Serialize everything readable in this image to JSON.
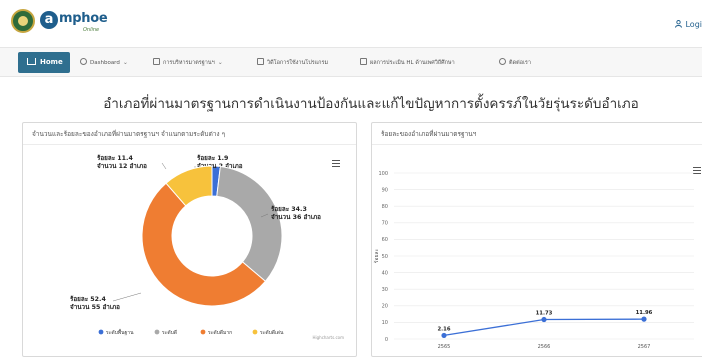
{
  "header": {
    "logo_letter": "a",
    "logo_word": "mphoe",
    "logo_sub": "Online",
    "login_label": "Logi"
  },
  "nav": {
    "home": "Home",
    "dashboard": "Dashboard",
    "manage_standards": "การบริหารมาตรฐานฯ",
    "manual": "วิดีโอการใช้งานโปรแกรม",
    "hl_results": "ผลการประเมิน HL ด้านเพศวิถีศึกษา",
    "contact": "ติดต่อเรา"
  },
  "page": {
    "title": "อำเภอที่ผ่านมาตรฐานการดำเนินงานป้องกันและแก้ไขปัญหาการตั้งครรภ์ในวัยรุ่นระดับอำเภอ"
  },
  "chart_data": [
    {
      "type": "pie",
      "title": "จำนวนและร้อยละของอำเภอที่ผ่านมาตรฐานฯ จำแนกตามระดับต่าง ๆ",
      "credit": "Highcharts.com",
      "legend_position": "bottom",
      "slices": [
        {
          "name": "ระดับพื้นฐาน",
          "percent": 1.9,
          "count": 2,
          "pct_label": "ร้อยละ 1.9",
          "count_label": "จำนวน 2 อำเภอ",
          "color": "#3b6fd6"
        },
        {
          "name": "ระดับดี",
          "percent": 34.3,
          "count": 36,
          "pct_label": "ร้อยละ 34.3",
          "count_label": "จำนวน 36 อำเภอ",
          "color": "#a9a9a9"
        },
        {
          "name": "ระดับดีมาก",
          "percent": 52.4,
          "count": 55,
          "pct_label": "ร้อยละ 52.4",
          "count_label": "จำนวน 55 อำเภอ",
          "color": "#ef7d32"
        },
        {
          "name": "ระดับดีเด่น",
          "percent": 11.4,
          "count": 12,
          "pct_label": "ร้อยละ 11.4",
          "count_label": "จำนวน 12 อำเภอ",
          "color": "#f7c23c"
        }
      ]
    },
    {
      "type": "line",
      "title": "ร้อยละของอำเภอที่ผ่านมาตรฐานฯ",
      "ylabel": "ร้อยละ",
      "ylim": [
        0,
        100
      ],
      "yticks": [
        "0",
        "10",
        "20",
        "30",
        "40",
        "50",
        "60",
        "70",
        "80",
        "90",
        "100"
      ],
      "x": [
        "2565",
        "2566",
        "2567"
      ],
      "values": [
        2.16,
        11.73,
        11.96
      ],
      "value_labels": [
        "2.16",
        "11.73",
        "11.96"
      ],
      "color": "#3b6fd6",
      "grid": true
    }
  ]
}
